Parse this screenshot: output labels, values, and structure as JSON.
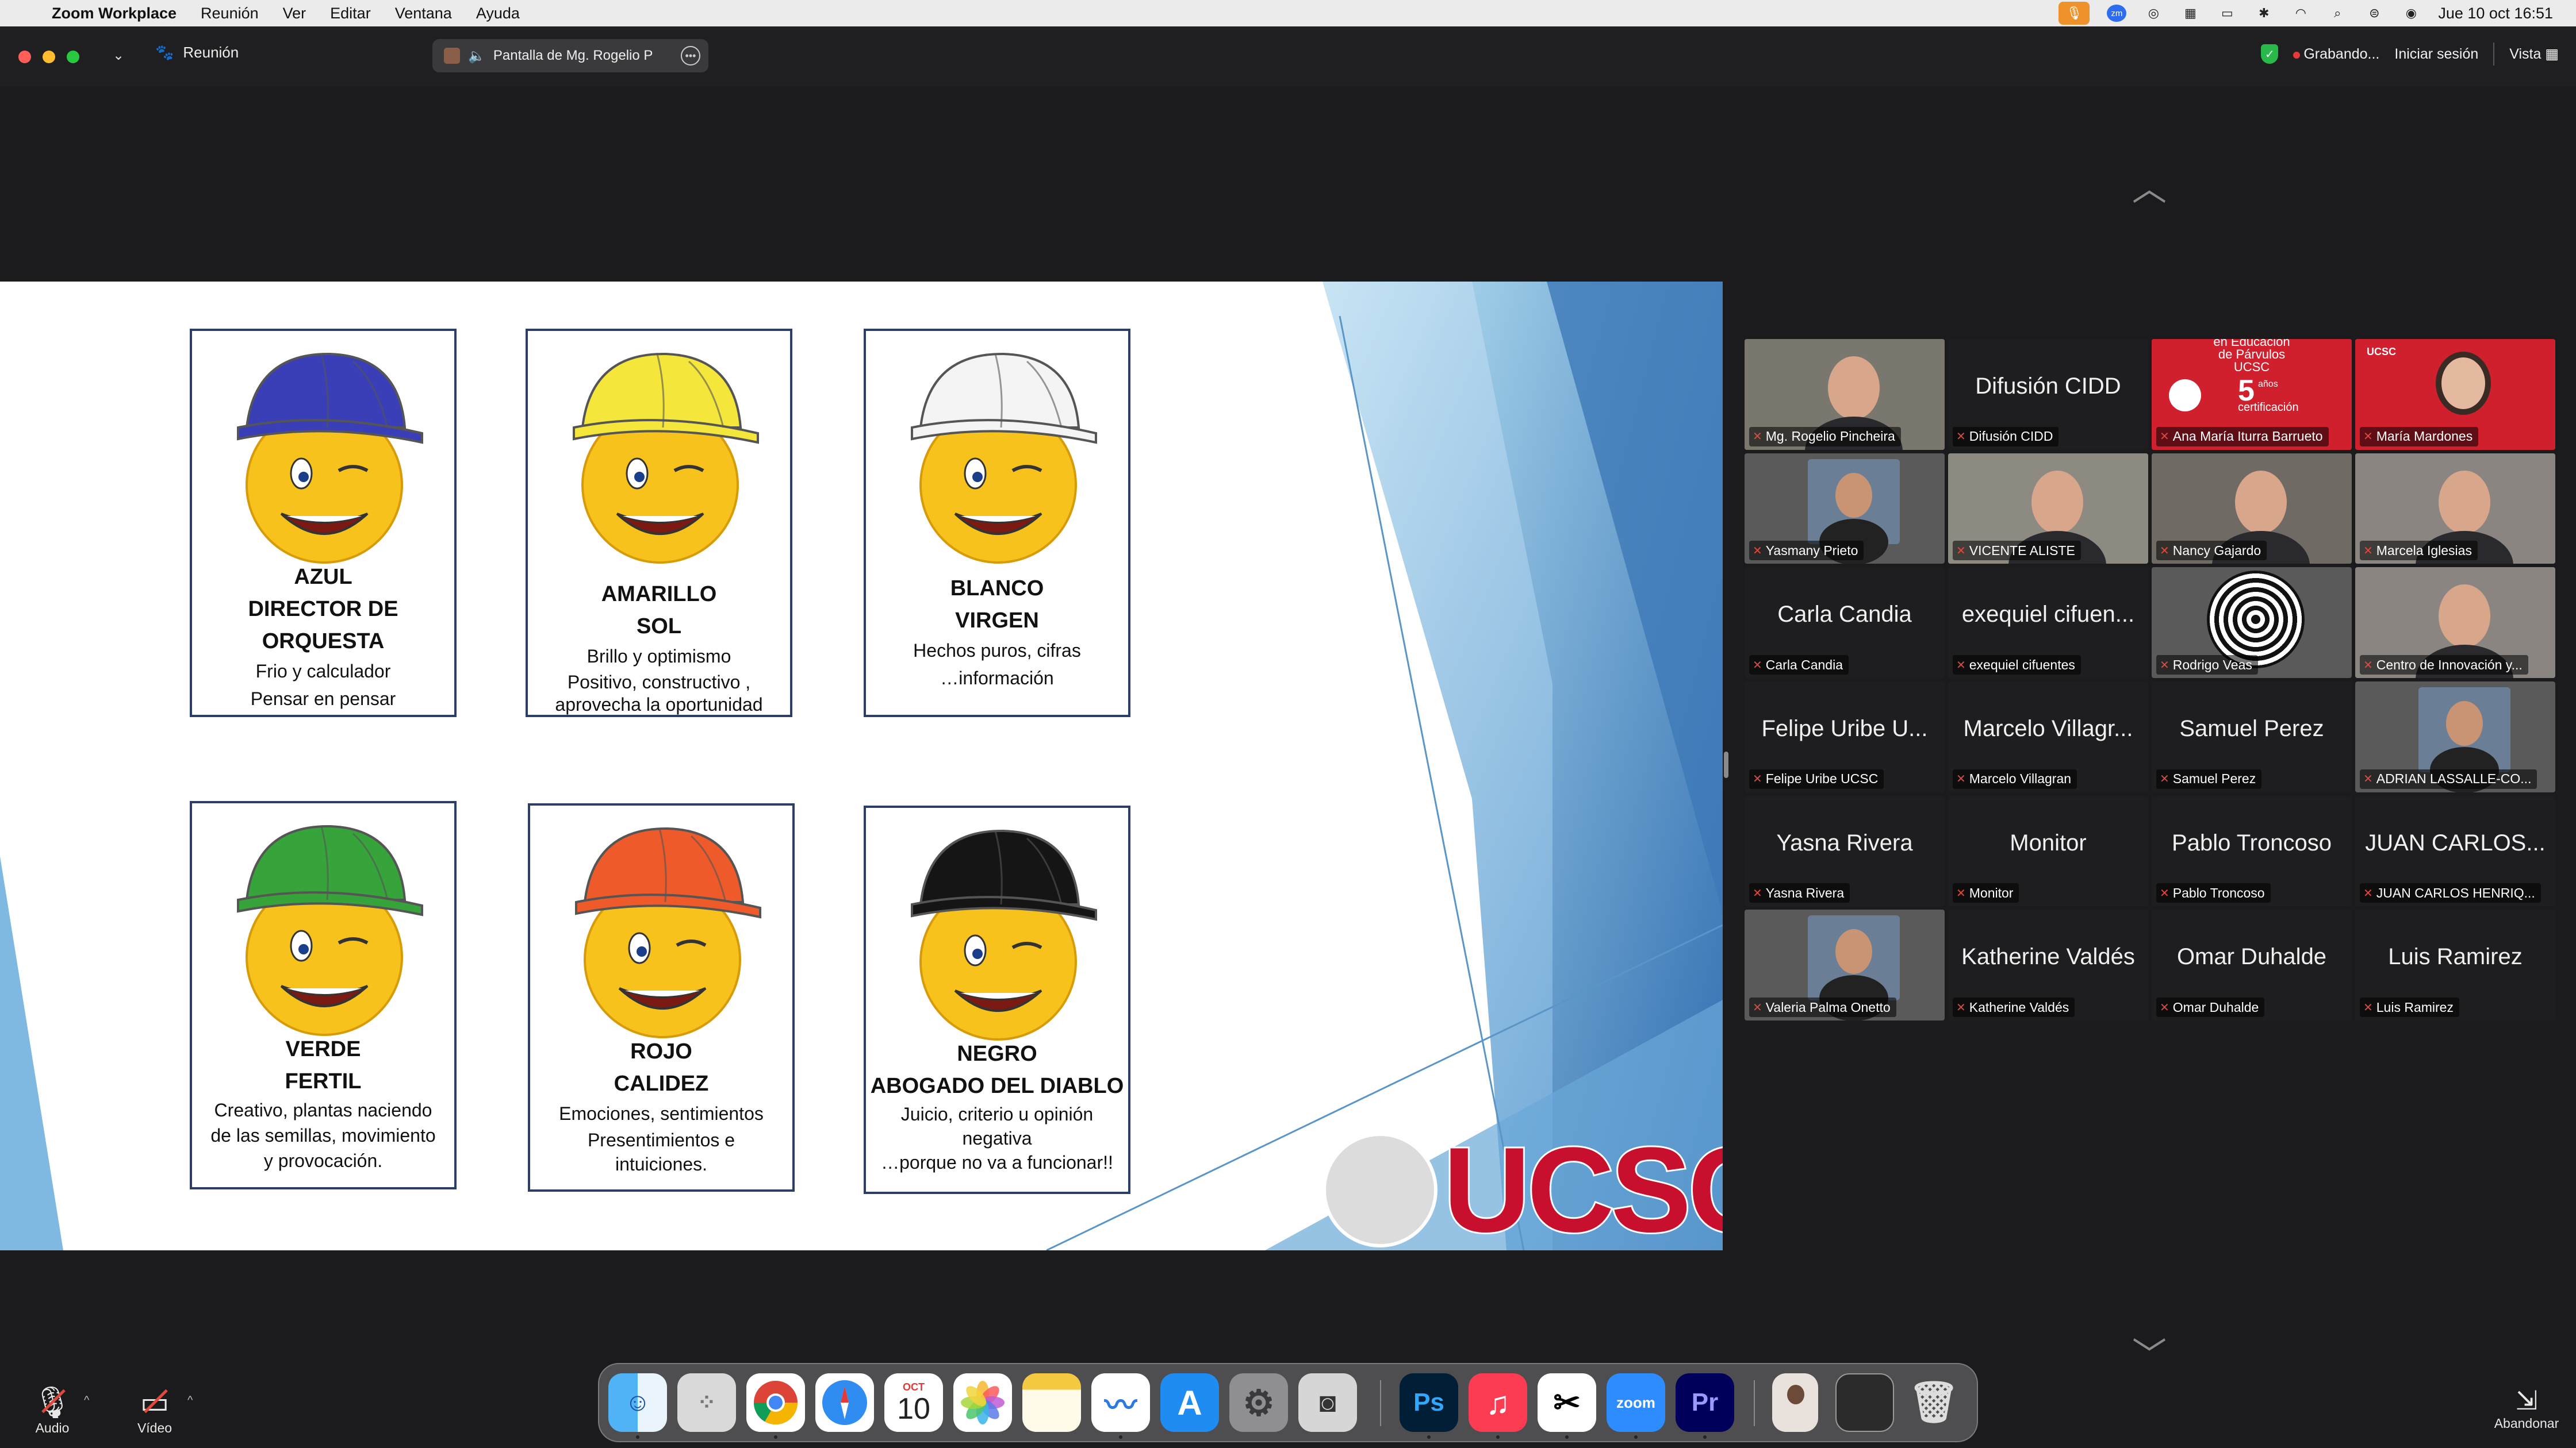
{
  "menubar": {
    "app": "Zoom Workplace",
    "items": [
      "Reunión",
      "Ver",
      "Editar",
      "Ventana",
      "Ayuda"
    ],
    "clock": "Jue 10 oct  16:51"
  },
  "titlebar": {
    "meeting": "Reunión",
    "share": "Pantalla de Mg. Rogelio P",
    "recording": "Grabando...",
    "signin": "Iniciar sesión",
    "view": "Vista"
  },
  "slide": {
    "cards": [
      {
        "color": "#3a3fb8",
        "lines_bold": [
          "AZUL",
          "DIRECTOR DE",
          "ORQUESTA"
        ],
        "lines": [
          "Frio y calculador",
          "Pensar en pensar"
        ]
      },
      {
        "color": "#f4e63a",
        "lines_bold": [
          "AMARILLO",
          "SOL"
        ],
        "lines": [
          "Brillo y optimismo",
          "Positivo, constructivo ,",
          "aprovecha la oportunidad"
        ]
      },
      {
        "color": "#f4f4f4",
        "lines_bold": [
          "BLANCO",
          "VIRGEN"
        ],
        "lines": [
          "Hechos puros, cifras",
          "…información"
        ]
      },
      {
        "color": "#36a43a",
        "lines_bold": [
          "VERDE",
          "FERTIL"
        ],
        "lines": [
          "Creativo, plantas naciendo",
          "de las semillas, movimiento",
          "y provocación."
        ]
      },
      {
        "color": "#ee5a2a",
        "lines_bold": [
          "ROJO",
          "CALIDEZ"
        ],
        "lines": [
          "Emociones, sentimientos",
          "Presentimientos e",
          "intuiciones."
        ]
      },
      {
        "color": "#151515",
        "lines_bold": [
          "NEGRO",
          "ABOGADO DEL DIABLO"
        ],
        "lines": [
          "Juicio, criterio u opinión",
          "negativa",
          "…porque no va a funcionar!!"
        ]
      }
    ],
    "logo_text": "UCSC"
  },
  "participants": [
    {
      "name": "Mg. Rogelio Pincheira",
      "big": "",
      "kind": "video"
    },
    {
      "name": "Difusión CIDD",
      "big": "Difusión CIDD",
      "kind": "text"
    },
    {
      "name": "Ana María Iturra Barrueto",
      "big": "",
      "kind": "banner",
      "banner": [
        "en Educación",
        "de Párvulos",
        "UCSC",
        "5",
        "años",
        "certificación"
      ]
    },
    {
      "name": "María Mardones",
      "big": "",
      "kind": "banner2",
      "banner": [
        "UCSC"
      ]
    },
    {
      "name": "Yasmany Prieto",
      "big": "",
      "kind": "photo"
    },
    {
      "name": "VICENTE ALISTE",
      "big": "",
      "kind": "video"
    },
    {
      "name": "Nancy Gajardo",
      "big": "",
      "kind": "video",
      "speaking": true
    },
    {
      "name": "Marcela Iglesias",
      "big": "",
      "kind": "video"
    },
    {
      "name": "Carla Candia",
      "big": "Carla Candia",
      "kind": "text"
    },
    {
      "name": "exequiel cifuentes",
      "big": "exequiel cifuen...",
      "kind": "text"
    },
    {
      "name": "Rodrigo Veas",
      "big": "",
      "kind": "avatar"
    },
    {
      "name": "Centro de Innovación y...",
      "big": "",
      "kind": "video"
    },
    {
      "name": "Felipe Uribe UCSC",
      "big": "Felipe Uribe U...",
      "kind": "text"
    },
    {
      "name": "Marcelo Villagran",
      "big": "Marcelo Villagr...",
      "kind": "text"
    },
    {
      "name": "Samuel Perez",
      "big": "Samuel Perez",
      "kind": "text"
    },
    {
      "name": "ADRIAN LASSALLE-CO...",
      "big": "",
      "kind": "photo"
    },
    {
      "name": "Yasna Rivera",
      "big": "Yasna Rivera",
      "kind": "text"
    },
    {
      "name": "Monitor",
      "big": "Monitor",
      "kind": "text"
    },
    {
      "name": "Pablo Troncoso",
      "big": "Pablo Troncoso",
      "kind": "text"
    },
    {
      "name": "JUAN CARLOS HENRIQ...",
      "big": "JUAN CARLOS...",
      "kind": "text"
    },
    {
      "name": "Valeria Palma Onetto",
      "big": "",
      "kind": "photo"
    },
    {
      "name": "Katherine Valdés",
      "big": "Katherine Valdés",
      "kind": "text"
    },
    {
      "name": "Omar Duhalde",
      "big": "Omar Duhalde",
      "kind": "text"
    },
    {
      "name": "Luis Ramirez",
      "big": "Luis Ramirez",
      "kind": "text"
    }
  ],
  "controls": {
    "audio": "Audio",
    "video": "Vídeo",
    "leave": "Abandonar"
  },
  "dock": {
    "calendar_month": "OCT",
    "calendar_day": "10",
    "apps": [
      "finder-icon",
      "launchpad-icon",
      "chrome-icon",
      "safari-icon",
      "calendar-icon",
      "photos-icon",
      "notes-icon",
      "freeform-icon",
      "app-store-icon",
      "system-settings-icon",
      "screenshot-icon",
      "photoshop-icon",
      "music-icon",
      "capcut-icon",
      "zoom-icon",
      "premiere-icon",
      "recent-doc-icon",
      "recent-window-icon",
      "trash-icon"
    ],
    "labels": {
      "ps": "Ps",
      "zoom": "zoom",
      "pr": "Pr"
    }
  }
}
